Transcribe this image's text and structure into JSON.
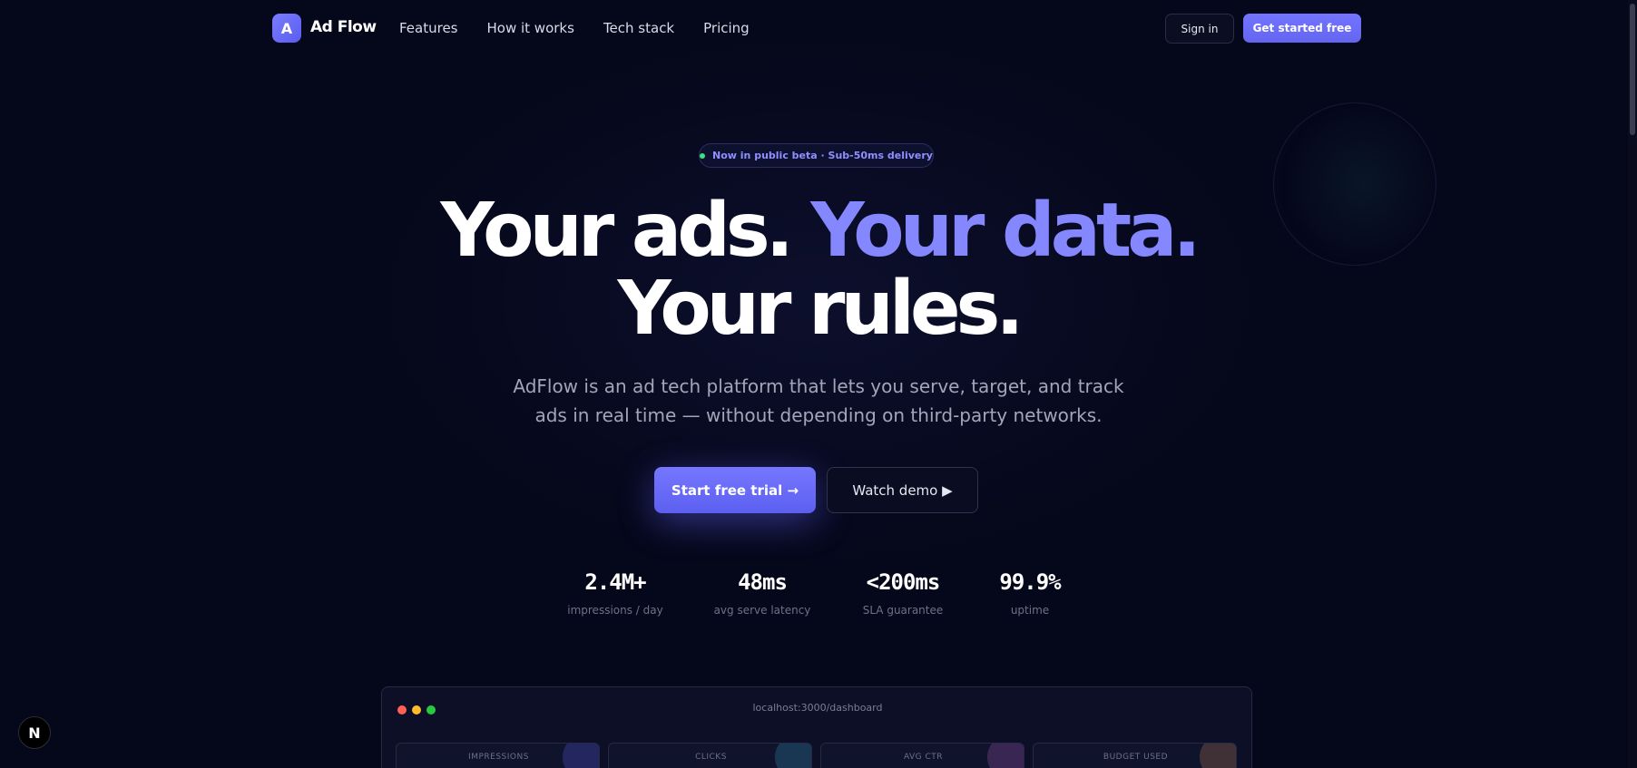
{
  "nav": {
    "logo_letter": "A",
    "brand": "Ad Flow",
    "links": [
      "Features",
      "How it works",
      "Tech stack",
      "Pricing"
    ],
    "signin": "Sign in",
    "get_started": "Get started free"
  },
  "hero": {
    "badge": "Now in public beta · Sub-50ms delivery",
    "headline_part1": "Your ads. ",
    "headline_accent": "Your data.",
    "headline_line2": "Your rules.",
    "subtitle": "AdFlow is an ad tech platform that lets you serve, target, and track ads in real time — without depending on third-party networks.",
    "cta_primary": "Start free trial →",
    "cta_secondary": "Watch demo ▶"
  },
  "stats": [
    {
      "value": "2.4M+",
      "label": "impressions / day"
    },
    {
      "value": "48ms",
      "label": "avg serve latency"
    },
    {
      "value": "<200ms",
      "label": "SLA guarantee"
    },
    {
      "value": "99.9%",
      "label": "uptime"
    }
  ],
  "dashboard": {
    "url": "localhost:3000/dashboard",
    "cards": [
      "IMPRESSIONS",
      "CLICKS",
      "AVG CTR",
      "BUDGET USED"
    ]
  },
  "dev_badge": "N",
  "colors": {
    "background": "#05071a",
    "accent": "#8587ff",
    "primary_button": "#6466f5",
    "status_green": "#3ee07a"
  }
}
